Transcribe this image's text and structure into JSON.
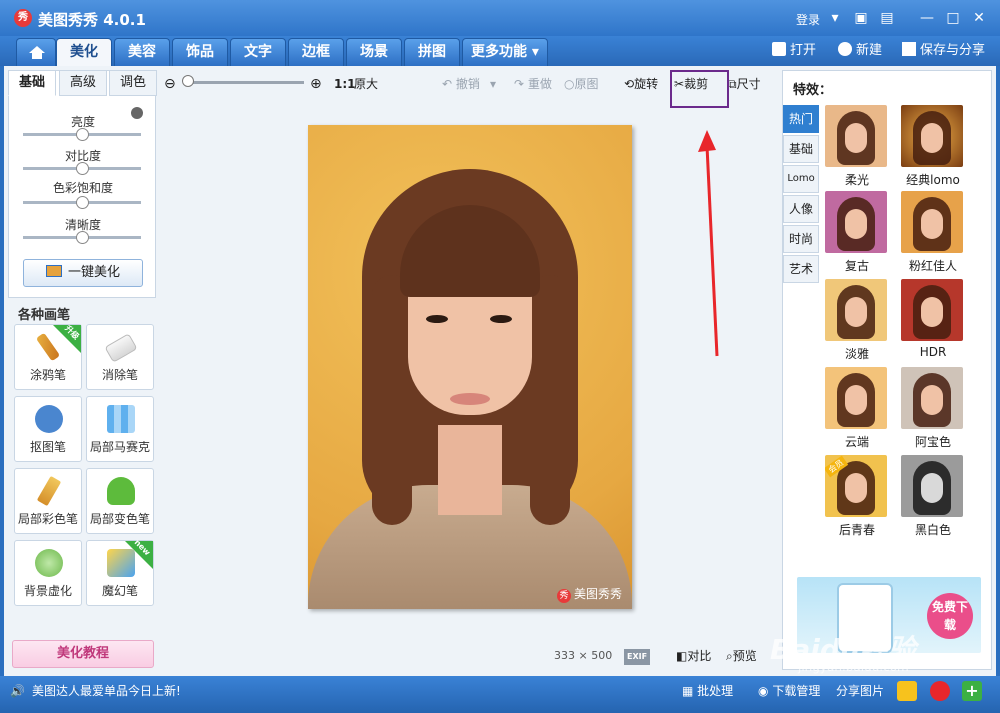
{
  "window": {
    "title": "美图秀秀 4.0.1",
    "logo_text": "秀",
    "login": "登录"
  },
  "tabs": [
    "美化",
    "美容",
    "饰品",
    "文字",
    "边框",
    "场景",
    "拼图",
    "更多功能"
  ],
  "top_actions": {
    "open": "打开",
    "new": "新建",
    "save_share": "保存与分享"
  },
  "left": {
    "subtabs": [
      "基础",
      "高级",
      "调色"
    ],
    "sliders": [
      {
        "label": "亮度",
        "value": 0.5
      },
      {
        "label": "对比度",
        "value": 0.5
      },
      {
        "label": "色彩饱和度",
        "value": 0.5
      },
      {
        "label": "清晰度",
        "value": 0.5
      }
    ],
    "one_click": "一键美化",
    "pens_title": "各种画笔",
    "pens": [
      "涂鸦笔",
      "消除笔",
      "抠图笔",
      "局部马赛克",
      "局部彩色笔",
      "局部变色笔",
      "背景虚化",
      "魔幻笔"
    ],
    "badge_upgrade": "升级",
    "badge_new": "new",
    "tutorial": "美化教程"
  },
  "toolbar": {
    "ratio": "1:1",
    "original_size": "原大",
    "undo": "撤销",
    "redo": "重做",
    "original": "原图",
    "rotate": "旋转",
    "crop": "裁剪",
    "size": "尺寸",
    "zoom_value": 0.0
  },
  "canvas": {
    "watermark": "美图秀秀",
    "width": "333",
    "times": "×",
    "height": "500",
    "exif": "EXIF",
    "compare": "对比",
    "preview": "预览"
  },
  "right": {
    "title": "特效：",
    "categories": [
      "热门",
      "基础",
      "Lomo",
      "人像",
      "时尚",
      "艺术"
    ],
    "effects": [
      "柔光",
      "经典lomo",
      "复古",
      "粉红佳人",
      "淡雅",
      "HDR",
      "云端",
      "阿宝色",
      "后青春",
      "黑白色"
    ],
    "ad_button": "免费下载",
    "vip_badge": "会员"
  },
  "statusbar": {
    "message": "美图达人最爱单品今日上新!",
    "batch": "批处理",
    "download_manage": "下载管理",
    "share_pic": "分享图片"
  },
  "watermark": {
    "brand": "Baidu经验",
    "url": "jingyan.baidu.com"
  },
  "colors": {
    "accent": "#2f7fd0",
    "highlight_box": "#6b2a8c",
    "arrow": "#e8262b"
  }
}
